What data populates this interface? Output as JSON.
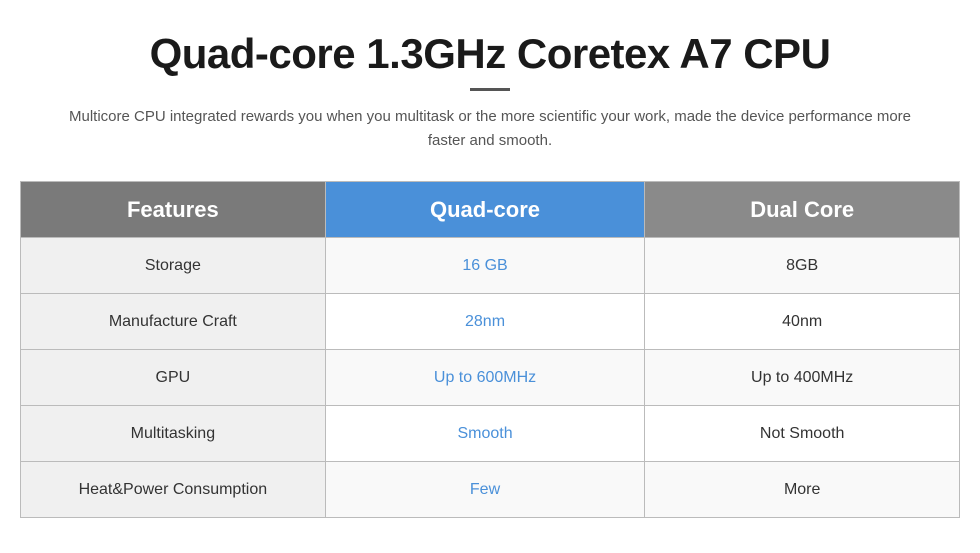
{
  "header": {
    "title": "Quad-core 1.3GHz Coretex A7 CPU",
    "subtitle": "Multicore CPU integrated rewards you when you multitask or the more scientific your work, made the device performance more faster and smooth."
  },
  "table": {
    "columns": {
      "features": "Features",
      "quadcore": "Quad-core",
      "dualcore": "Dual Core"
    },
    "rows": [
      {
        "feature": "Storage",
        "quad": "16 GB",
        "dual": "8GB"
      },
      {
        "feature": "Manufacture Craft",
        "quad": "28nm",
        "dual": "40nm"
      },
      {
        "feature": "GPU",
        "quad": "Up to 600MHz",
        "dual": "Up to 400MHz"
      },
      {
        "feature": "Multitasking",
        "quad": "Smooth",
        "dual": "Not Smooth"
      },
      {
        "feature": "Heat&Power Consumption",
        "quad": "Few",
        "dual": "More"
      }
    ]
  }
}
